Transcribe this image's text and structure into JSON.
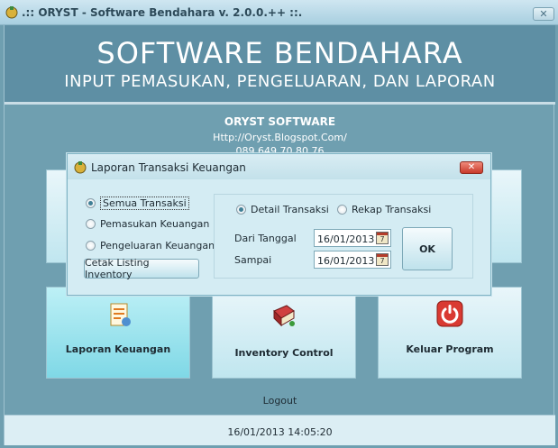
{
  "window": {
    "title": ".:: ORYST - Software Bendahara v. 2.0.0.++ ::.",
    "close": "✕"
  },
  "banner": {
    "title": "SOFTWARE BENDAHARA",
    "subtitle": "INPUT PEMASUKAN, PENGELUARAN, DAN LAPORAN"
  },
  "info": {
    "brand": "ORYST SOFTWARE",
    "url": "Http://Oryst.Blogspot.Com/",
    "phone": "089 649 70 80 76"
  },
  "tiles": [
    {
      "label": "Laporan Keuangan",
      "icon": "report-icon"
    },
    {
      "label": "Inventory Control",
      "icon": "book-icon"
    },
    {
      "label": "Keluar Program",
      "icon": "power-icon"
    }
  ],
  "logout": "Logout",
  "status": {
    "datetime": "16/01/2013 14:05:20"
  },
  "dialog": {
    "title": "Laporan Transaksi Keuangan",
    "close": "✕",
    "filter": [
      {
        "label": "Semua Transaksi",
        "checked": true
      },
      {
        "label": "Pemasukan Keuangan",
        "checked": false
      },
      {
        "label": "Pengeluaran Keuangan",
        "checked": false
      }
    ],
    "listing_button": "Cetak Listing Inventory",
    "mode": [
      {
        "label": "Detail Transaksi",
        "checked": true
      },
      {
        "label": "Rekap Transaksi",
        "checked": false
      }
    ],
    "from_label": "Dari Tanggal",
    "from_value": "16/01/2013",
    "to_label": "Sampai",
    "to_value": "16/01/2013",
    "calendar_glyph": "7",
    "ok": "OK"
  }
}
